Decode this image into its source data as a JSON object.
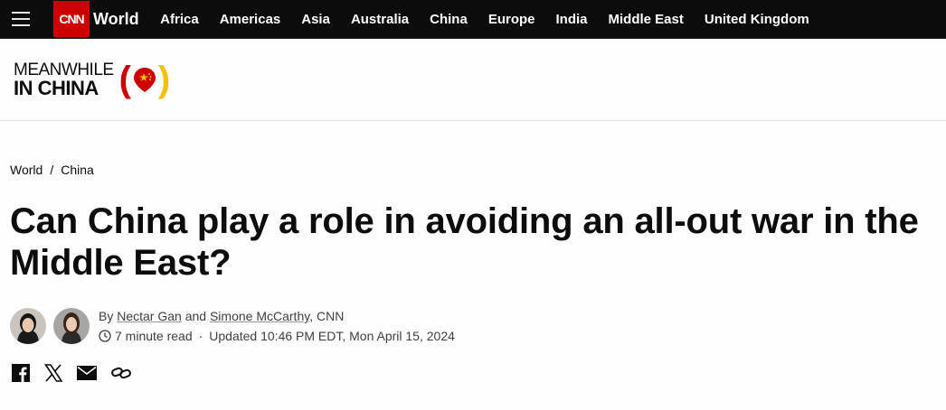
{
  "topnav": {
    "logo_text": "CNN",
    "section": "World",
    "links": [
      "Africa",
      "Americas",
      "Asia",
      "Australia",
      "China",
      "Europe",
      "India",
      "Middle East",
      "United Kingdom"
    ]
  },
  "brand": {
    "line1": "MEANWHILE",
    "line2": "IN CHINA",
    "paren_left": "(",
    "paren_right": ")"
  },
  "breadcrumb": {
    "items": [
      "World",
      "China"
    ],
    "separator": "/"
  },
  "headline": "Can China play a role in avoiding an all-out war in the Middle East?",
  "byline": {
    "prefix": "By",
    "author1": "Nectar Gan",
    "and": "and",
    "author2": "Simone McCarthy",
    "outlet": ", CNN",
    "read_time": "7 minute read",
    "sep": "·",
    "updated": "Updated 10:46 PM EDT, Mon April 15, 2024"
  },
  "colors": {
    "brand_red": "#cc0000",
    "brand_yellow": "#f2c200",
    "nav_bg": "#0c0c0c"
  },
  "share_icons": [
    "facebook-icon",
    "x-icon",
    "email-icon",
    "link-icon"
  ]
}
